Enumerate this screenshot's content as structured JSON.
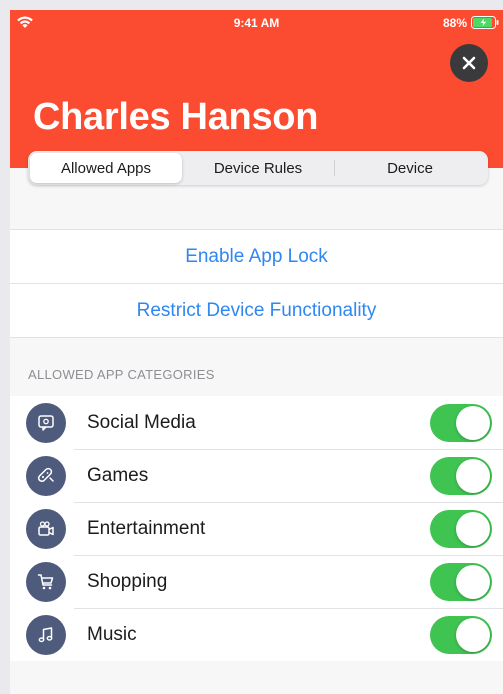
{
  "status_bar": {
    "time": "9:41 AM",
    "battery": "88%",
    "wifi_icon": "wifi-icon",
    "battery_icon": "battery-charging-icon"
  },
  "header": {
    "title": "Charles Hanson",
    "close_icon": "close-icon",
    "background_color": "#fb4c32"
  },
  "tabs": [
    {
      "label": "Allowed Apps",
      "selected": true
    },
    {
      "label": "Device Rules",
      "selected": false
    },
    {
      "label": "Device",
      "selected": false
    }
  ],
  "actions": [
    {
      "label": "Enable App Lock"
    },
    {
      "label": "Restrict Device Functionality"
    }
  ],
  "section_header": "ALLOWED APP CATEGORIES",
  "categories": [
    {
      "label": "Social Media",
      "icon": "social-media-icon",
      "enabled": true
    },
    {
      "label": "Games",
      "icon": "gamepad-icon",
      "enabled": true
    },
    {
      "label": "Entertainment",
      "icon": "video-camera-icon",
      "enabled": true
    },
    {
      "label": "Shopping",
      "icon": "shopping-cart-icon",
      "enabled": true
    },
    {
      "label": "Music",
      "icon": "music-note-icon",
      "enabled": true
    }
  ],
  "colors": {
    "accent_link": "#2f87f0",
    "toggle_on": "#3fc452",
    "icon_background": "#4f5b7c"
  }
}
